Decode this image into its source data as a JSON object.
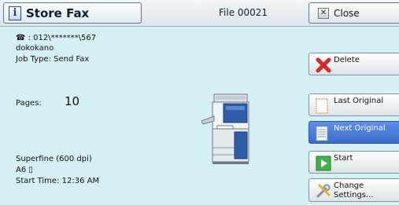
{
  "header": {
    "title": "Store Fax",
    "file_label": "File 00021",
    "close_label": "Close"
  },
  "job": {
    "fax_number": "☎ : 012\\*******\\567",
    "sender": "dokokano",
    "job_type": "Job Type: Send Fax",
    "pages_label": "Pages:",
    "pages_value": "10",
    "resolution": "Superfine (600 dpi)",
    "paper_size": "A6 ▯",
    "start_time": "Start Time: 12:36 AM"
  },
  "actions": {
    "delete": "Delete",
    "last_original": "Last Original",
    "next_original": "Next Original",
    "start": "Start",
    "change_line1": "Change",
    "change_line2": "Settings..."
  },
  "icons": {
    "title": "info-icon",
    "close": "close-x-icon",
    "delete": "red-x-icon",
    "last_original": "blank-page-icon",
    "next_original": "lined-page-icon",
    "start": "green-play-icon",
    "change": "tools-icon",
    "illustration": "printer-icon"
  },
  "colors": {
    "background": "#d4f0f2",
    "selected_button": "#4a7bd8",
    "delete_icon": "#d42a2a",
    "start_icon": "#3fb24a"
  }
}
